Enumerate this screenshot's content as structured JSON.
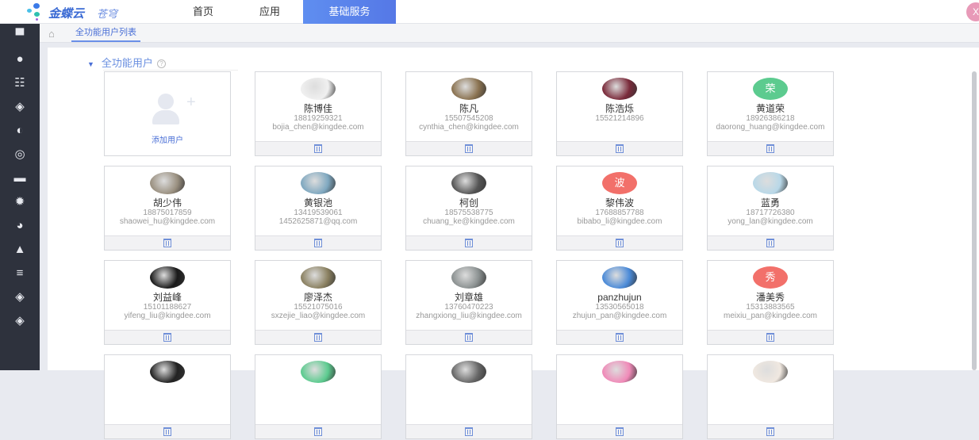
{
  "header": {
    "logo_brand": "金蝶云",
    "logo_product": "苍穹",
    "nav": [
      {
        "label": "首页"
      },
      {
        "label": "应用"
      },
      {
        "label": "基础服务",
        "active": true
      }
    ],
    "user_initial": "X"
  },
  "sidebar": {
    "icons": [
      "desktop-icon",
      "user-icon",
      "org-chart-icon",
      "layers-icon",
      "shield-icon",
      "compass-icon",
      "monitor-icon",
      "gear-icon",
      "globe-icon",
      "user-stamp-icon",
      "list-icon",
      "layers-icon",
      "layers-icon"
    ]
  },
  "breadcrumb": {
    "tab": "全功能用户列表"
  },
  "section": {
    "title": "全功能用户",
    "help": "?",
    "add_label": "添加用户"
  },
  "users": [
    {
      "name": "陈博佳",
      "phone": "18819259321",
      "email": "bojia_chen@kingdee.com",
      "avatar": "photo",
      "color": "#f0f0f0"
    },
    {
      "name": "陈凡",
      "phone": "15507545208",
      "email": "cynthia_chen@kingdee.com",
      "avatar": "photo",
      "color": "#8a7250"
    },
    {
      "name": "陈浩烁",
      "phone": "15521214896",
      "email": "",
      "avatar": "photo",
      "color": "#7a2a3a"
    },
    {
      "name": "黄道荣",
      "phone": "18926386218",
      "email": "daorong_huang@kingdee.com",
      "avatar": "荣",
      "color": "#5ccb8f"
    },
    {
      "name": "胡少伟",
      "phone": "18875017859",
      "email": "shaowei_hu@kingdee.com",
      "avatar": "photo",
      "color": "#9a9080"
    },
    {
      "name": "黄银池",
      "phone": "13419539061",
      "email": "1452625871@qq.com",
      "avatar": "photo",
      "color": "#7fa8c0"
    },
    {
      "name": "柯创",
      "phone": "18575538775",
      "email": "chuang_ke@kingdee.com",
      "avatar": "photo",
      "color": "#555"
    },
    {
      "name": "黎伟波",
      "phone": "17688857788",
      "email": "bibabo_li@kingdee.com",
      "avatar": "波",
      "color": "#f2706a"
    },
    {
      "name": "蓝勇",
      "phone": "18717726380",
      "email": "yong_lan@kingdee.com",
      "avatar": "photo",
      "color": "#b8d8e8"
    },
    {
      "name": "刘益峰",
      "phone": "15101188627",
      "email": "yifeng_liu@kingdee.com",
      "avatar": "photo",
      "color": "#1a1a1a"
    },
    {
      "name": "廖泽杰",
      "phone": "15521075016",
      "email": "sxzejie_liao@kingdee.com",
      "avatar": "photo",
      "color": "#8a8060"
    },
    {
      "name": "刘章雄",
      "phone": "13760470223",
      "email": "zhangxiong_liu@kingdee.com",
      "avatar": "photo",
      "color": "#8a9090"
    },
    {
      "name": "panzhujun",
      "phone": "13530565018",
      "email": "zhujun_pan@kingdee.com",
      "avatar": "photo",
      "color": "#4a8ad8"
    },
    {
      "name": "潘美秀",
      "phone": "15313883565",
      "email": "meixiu_pan@kingdee.com",
      "avatar": "秀",
      "color": "#f2706a"
    },
    {
      "name": "",
      "phone": "",
      "email": "",
      "avatar": "photo",
      "color": "#222"
    },
    {
      "name": "",
      "phone": "",
      "email": "",
      "avatar": "photo",
      "color": "#5ccb8f"
    },
    {
      "name": "",
      "phone": "",
      "email": "",
      "avatar": "photo",
      "color": "#666"
    },
    {
      "name": "",
      "phone": "",
      "email": "",
      "avatar": "photo",
      "color": "#f08ab8"
    },
    {
      "name": "",
      "phone": "",
      "email": "",
      "avatar": "photo",
      "color": "#f0e8e0"
    }
  ]
}
